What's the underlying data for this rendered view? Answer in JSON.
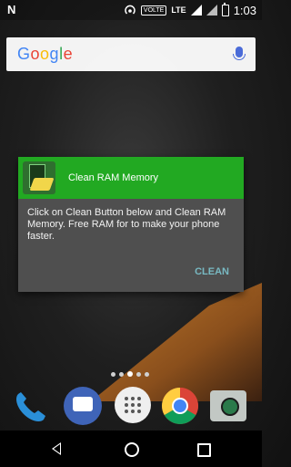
{
  "status_bar": {
    "notification_icon": "N",
    "network_badge": "VOLTE",
    "network_type": "LTE",
    "time": "1:03"
  },
  "search_bar": {
    "logo_text": "Google",
    "icon": "mic-icon"
  },
  "dialog": {
    "title": "Clean RAM Memory",
    "message": "Click on Clean Button below and Clean RAM Memory. Free RAM for to make your phone faster.",
    "button_label": "CLEAN"
  },
  "page_indicator": {
    "count": 5,
    "active_index": 2
  },
  "dock": [
    "phone-icon",
    "messages-icon",
    "app-drawer-icon",
    "chrome-icon",
    "camera-icon"
  ],
  "nav": [
    "back-icon",
    "home-icon",
    "recents-icon"
  ]
}
